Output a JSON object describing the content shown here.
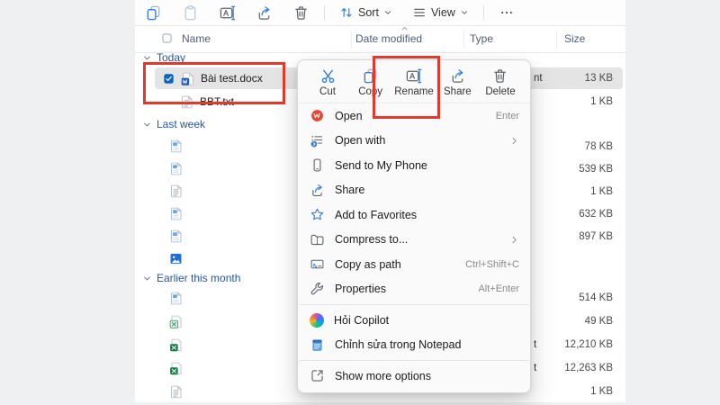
{
  "toolbar": {
    "buttons": [
      {
        "icon": "copy",
        "enabled": true
      },
      {
        "icon": "paste",
        "enabled": false
      },
      {
        "icon": "rename",
        "enabled": true
      },
      {
        "icon": "share",
        "enabled": true
      },
      {
        "icon": "delete",
        "enabled": true
      }
    ],
    "sort_label": "Sort",
    "view_label": "View"
  },
  "columns": {
    "name": "Name",
    "date_modified": "Date modified",
    "type": "Type",
    "size": "Size"
  },
  "filelist": {
    "groups": [
      {
        "label": "Today",
        "rows": [
          {
            "icon": "word-file",
            "name": "Bài test.docx",
            "size": "13 KB",
            "type_fragment": "nt",
            "selected": true,
            "checked": true
          },
          {
            "icon": "txt-file",
            "name": "BBT.txt",
            "size": "1 KB"
          }
        ]
      },
      {
        "label": "Last week",
        "rows": [
          {
            "icon": "doc-file",
            "size": "78 KB"
          },
          {
            "icon": "doc-file",
            "size": "539 KB"
          },
          {
            "icon": "txt-file",
            "size": "1 KB"
          },
          {
            "icon": "doc-file",
            "size": "632 KB"
          },
          {
            "icon": "doc-file",
            "size": "897 KB"
          },
          {
            "icon": "image-file",
            "size": ""
          }
        ]
      },
      {
        "label": "Earlier this month",
        "rows": [
          {
            "icon": "doc-file",
            "size": "514 KB"
          },
          {
            "icon": "excel-file-light",
            "size": "49 KB"
          },
          {
            "icon": "excel-file",
            "size": "12,210 KB",
            "type_fragment": "t"
          },
          {
            "icon": "excel-file",
            "size": "12,263 KB",
            "type_fragment": "t"
          },
          {
            "icon": "txt-file",
            "size": "1 KB"
          }
        ]
      }
    ]
  },
  "context_menu": {
    "commands": [
      {
        "icon": "cut",
        "label": "Cut"
      },
      {
        "icon": "copy",
        "label": "Copy"
      },
      {
        "icon": "rename",
        "label": "Rename",
        "highlighted": true
      },
      {
        "icon": "share",
        "label": "Share"
      },
      {
        "icon": "delete",
        "label": "Delete"
      }
    ],
    "items": [
      {
        "icon": "wps",
        "label": "Open",
        "shortcut": "Enter"
      },
      {
        "icon": "open-with",
        "label": "Open with",
        "submenu": true
      },
      {
        "icon": "phone",
        "label": "Send to My Phone"
      },
      {
        "icon": "share",
        "label": "Share"
      },
      {
        "icon": "star",
        "label": "Add to Favorites"
      },
      {
        "icon": "compress",
        "label": "Compress to...",
        "submenu": true
      },
      {
        "icon": "copy-path",
        "label": "Copy as path",
        "shortcut": "Ctrl+Shift+C"
      },
      {
        "icon": "properties",
        "label": "Properties",
        "shortcut": "Alt+Enter"
      },
      {
        "separator": true
      },
      {
        "icon": "copilot",
        "label": "Hỏi Copilot"
      },
      {
        "icon": "notepad",
        "label": "Chỉnh sửa trong Notepad"
      },
      {
        "separator": true
      },
      {
        "icon": "show-more",
        "label": "Show more options"
      }
    ]
  },
  "annotations": {
    "color": "#e0392e"
  }
}
